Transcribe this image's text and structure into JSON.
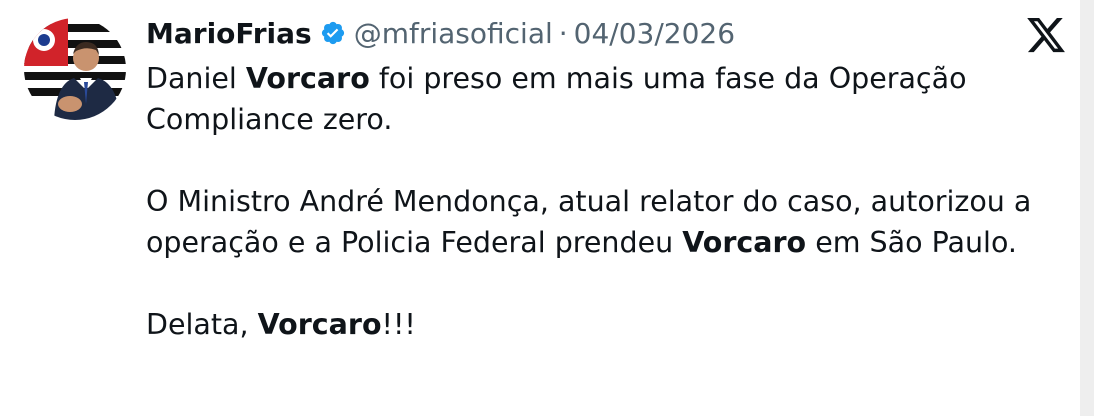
{
  "author": {
    "display_name": "MarioFrias",
    "handle": "@mfriasoficial",
    "separator": "·",
    "date": "04/03/2026",
    "verified": true,
    "verified_color": "#1d9bf0"
  },
  "platform_logo": "x-logo-icon",
  "tweet": {
    "paragraphs": [
      {
        "segments": [
          {
            "text": "Daniel ",
            "bold": false
          },
          {
            "text": "Vorcaro",
            "bold": true
          },
          {
            "text": " foi preso em mais uma fase da Operação Compliance zero.",
            "bold": false
          }
        ]
      },
      {
        "segments": [
          {
            "text": "O Ministro André Mendonça, atual relator do caso, autorizou a operação e a Policia Federal prendeu ",
            "bold": false
          },
          {
            "text": "Vorcaro",
            "bold": true
          },
          {
            "text": " em São Paulo.",
            "bold": false
          }
        ]
      },
      {
        "segments": [
          {
            "text": "Delata, ",
            "bold": false
          },
          {
            "text": "Vorcaro",
            "bold": true
          },
          {
            "text": "!!!",
            "bold": false
          }
        ]
      }
    ]
  },
  "colors": {
    "text_primary": "#0f1419",
    "text_secondary": "#536471",
    "background": "#ffffff"
  }
}
